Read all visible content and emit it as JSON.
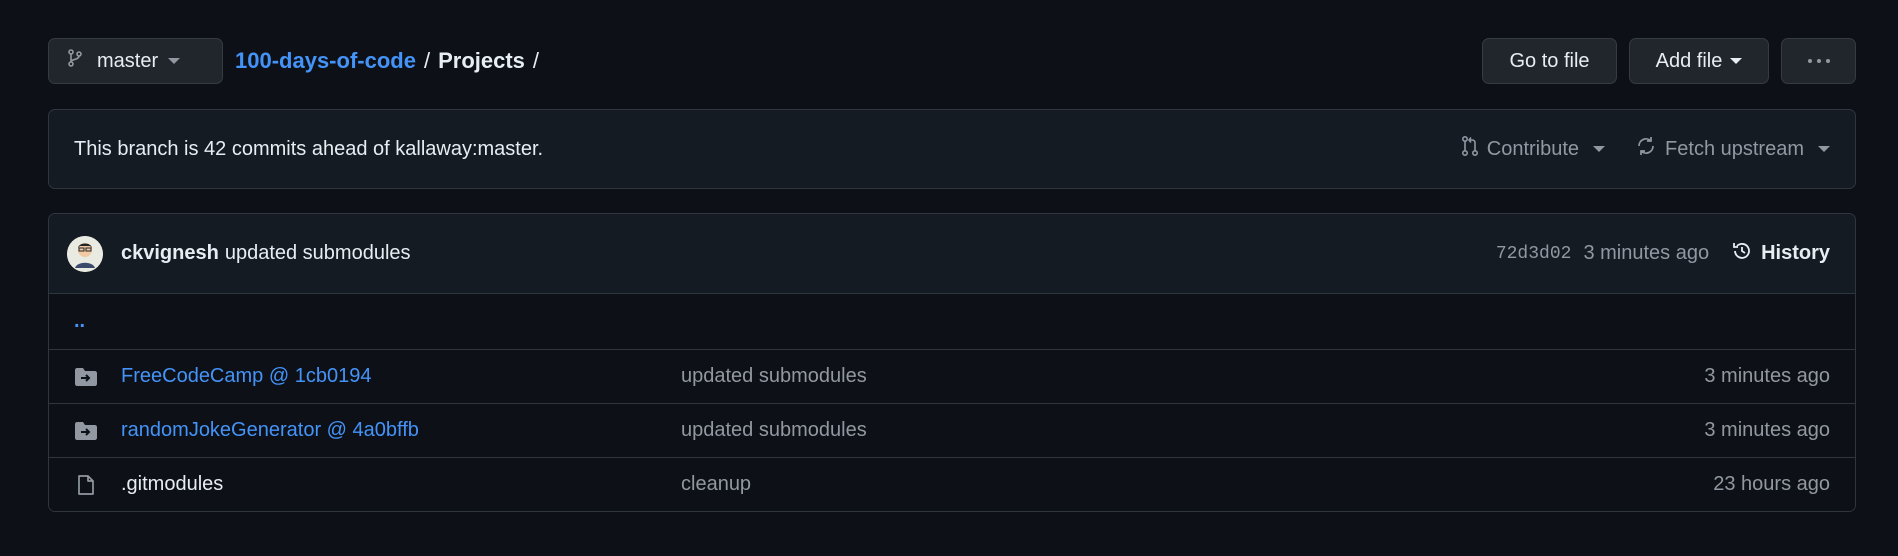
{
  "toolbar": {
    "branch": "master",
    "repo": "100-days-of-code",
    "sep1": "/",
    "folder": "Projects",
    "sep2": "/",
    "go_to_file": "Go to file",
    "add_file": "Add file"
  },
  "banner": {
    "text": "This branch is 42 commits ahead of kallaway:master.",
    "contribute": "Contribute",
    "fetch_upstream": "Fetch upstream"
  },
  "commit": {
    "author": "ckvignesh",
    "message": "updated submodules",
    "sha": "72d3d02",
    "time": "3 minutes ago",
    "history": "History"
  },
  "parent_link": "..",
  "files": [
    {
      "icon": "submodule-folder-icon",
      "name": "FreeCodeCamp @ 1cb0194",
      "message": "updated submodules",
      "time": "3 minutes ago"
    },
    {
      "icon": "submodule-folder-icon",
      "name": "randomJokeGenerator @ 4a0bffb",
      "message": "updated submodules",
      "time": "3 minutes ago"
    },
    {
      "icon": "file-icon",
      "name": ".gitmodules",
      "message": "cleanup",
      "time": "23 hours ago"
    }
  ],
  "colors": {
    "background": "#0d1117",
    "link": "#4493f8",
    "muted": "#9198a1",
    "border": "#30363d"
  }
}
